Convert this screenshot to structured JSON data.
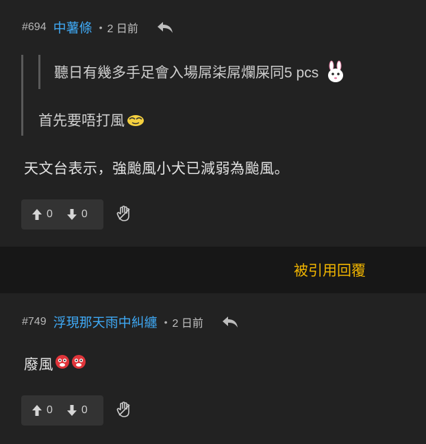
{
  "posts": [
    {
      "number": "#694",
      "username": "中薯條",
      "separator": "•",
      "time": "2 日前",
      "quote_line1": "聽日有幾多手足會入場屌柒屌爛屎同5 pcs",
      "quote_line2": "首先要唔打風",
      "body": "天文台表示，強颱風小犬已減弱為颱風。",
      "upvotes": "0",
      "downvotes": "0"
    },
    {
      "number": "#749",
      "username": "浮現那天雨中糾纏",
      "separator": "•",
      "time": "2 日前",
      "body": "廢風",
      "upvotes": "0",
      "downvotes": "0"
    }
  ],
  "quoted_reply_link": "被引用回覆",
  "colors": {
    "background": "#222222",
    "quote_bar": "#171717",
    "username": "#3fa9f5",
    "link": "#f0b400"
  },
  "icons": [
    "reply-icon",
    "thumb-up-arrow-icon",
    "thumb-down-arrow-icon",
    "hand-icon",
    "bunny-emoji-icon",
    "face-emoji-icon"
  ]
}
